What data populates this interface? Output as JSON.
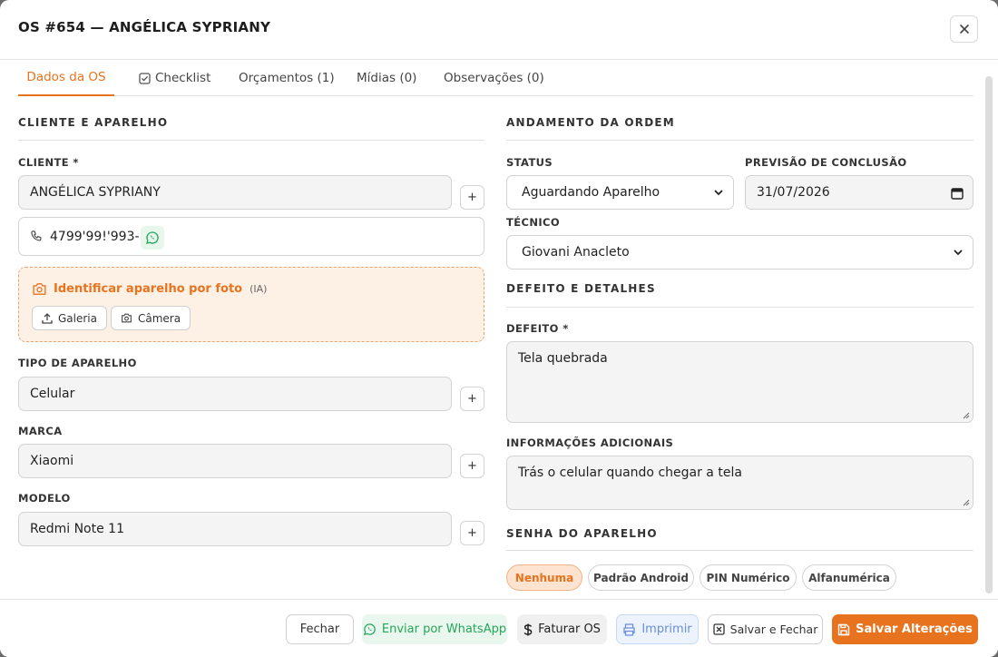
{
  "header": {
    "title": "OS #654 — ANGÉLICA SYPRIANY",
    "close": "×"
  },
  "tabs": [
    {
      "label": "Dados da OS"
    },
    {
      "label": "Checklist"
    },
    {
      "label": "Orçamentos (1)"
    },
    {
      "label": "Mídias (0)"
    },
    {
      "label": "Observações (0)"
    }
  ],
  "left": {
    "section_title": "CLIENTE E APARELHO",
    "cliente_label": "CLIENTE *",
    "cliente_value": "ANGÉLICA SYPRIANY",
    "phone": "4799'99!'993-:",
    "ai": {
      "title": "Identificar aparelho por foto",
      "tag": "(IA)",
      "galeria": "Galeria",
      "camera": "Câmera"
    },
    "tipo_label": "TIPO DE APARELHO",
    "tipo_value": "Celular",
    "marca_label": "MARCA",
    "marca_value": "Xiaomi",
    "modelo_label": "MODELO",
    "modelo_value": "Redmi Note 11",
    "plus": "+"
  },
  "right": {
    "section_title": "ANDAMENTO DA ORDEM",
    "status_label": "STATUS",
    "status_value": "Aguardando Aparelho",
    "previsao_label": "PREVISÃO DE CONCLUSÃO",
    "previsao_value": "31/07/2026",
    "tecnico_label": "TÉCNICO",
    "tecnico_value": "Giovani Anacleto",
    "defeito_section": "DEFEITO E DETALHES",
    "defeito_label": "DEFEITO *",
    "defeito_value": "Tela quebrada",
    "info_label": "INFORMAÇÕES ADICIONAIS",
    "info_value": "Trás o celular quando chegar a tela",
    "senha_section": "SENHA DO APARELHO",
    "senha_options": [
      "Nenhuma",
      "Padrão Android",
      "PIN Numérico",
      "Alfanumérica"
    ]
  },
  "footer": {
    "fechar": "Fechar",
    "whatsapp": "Enviar por WhatsApp",
    "faturar": "Faturar OS",
    "imprimir": "Imprimir",
    "salvar_fechar": "Salvar e Fechar",
    "salvar": "Salvar Alterações"
  },
  "colors": {
    "accent": "#e8731f",
    "whatsapp": "#25a55a",
    "print": "#6b8fd6"
  }
}
